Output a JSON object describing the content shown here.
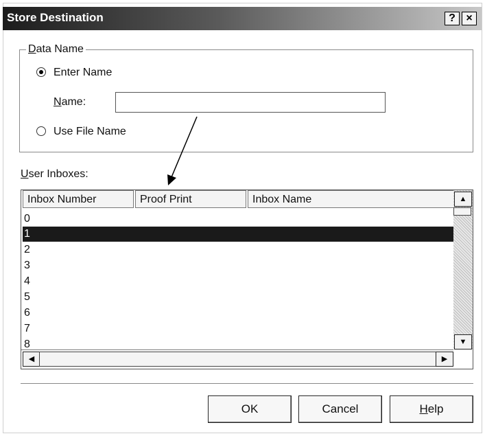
{
  "window": {
    "title": "Store Destination",
    "help_button": "?",
    "close_button": "×"
  },
  "data_name_group": {
    "label_hotkey": "D",
    "label_rest": "ata Name",
    "enter_name_label": "Enter Name",
    "enter_name_selected": true,
    "name_label_hotkey": "N",
    "name_label_rest": "ame:",
    "name_value": "",
    "use_file_name_label": "Use File Name",
    "use_file_name_selected": false
  },
  "inboxes": {
    "label_hotkey": "U",
    "label_rest": "ser Inboxes:",
    "columns": [
      "Inbox Number",
      "Proof Print",
      "Inbox Name"
    ],
    "rows": [
      "0",
      "1",
      "2",
      "3",
      "4",
      "5",
      "6",
      "7",
      "8"
    ],
    "selected_row": "1"
  },
  "buttons": {
    "ok_hotkey": "",
    "ok_label": "OK",
    "cancel_label": "Cancel",
    "help_hotkey": "H",
    "help_rest": "elp"
  },
  "icons": {
    "scroll_up": "triangle-up-icon",
    "scroll_down": "triangle-down-icon",
    "scroll_left": "triangle-left-icon",
    "scroll_right": "triangle-right-icon"
  },
  "colors": {
    "selection": "#1a1a1a",
    "title_gradient_start": "#1c1c1c"
  }
}
